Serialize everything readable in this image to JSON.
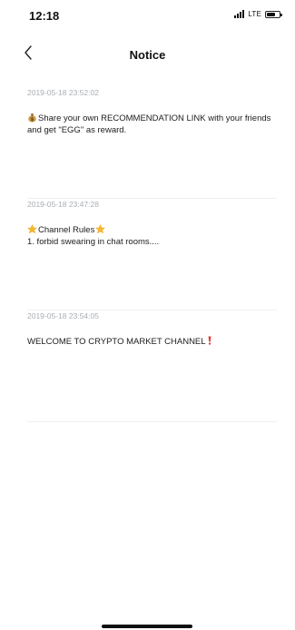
{
  "status_bar": {
    "time": "12:18",
    "network": "LTE",
    "icons": [
      "signal-icon",
      "battery-icon"
    ]
  },
  "header": {
    "title": "Notice",
    "back_icon": "chevron-left-icon"
  },
  "notices": [
    {
      "timestamp": "2019-05-18 23:52:02",
      "lead_icon": "money-bag-icon",
      "text": "Share your own RECOMMENDATION LINK with your friends and get \"EGG\" as reward."
    },
    {
      "timestamp": "2019-05-18 23:47:28",
      "title_icon": "star-icon",
      "title": "Channel Rules",
      "text": "1. forbid swearing in chat rooms...."
    },
    {
      "timestamp": "2019-05-18 23:54:05",
      "trail_icon": "exclamation-icon",
      "text": "WELCOME TO CRYPTO MARKET CHANNEL"
    }
  ],
  "colors": {
    "background": "#ffffff",
    "text": "#1c1c1c",
    "timestamp": "#a9aeb6",
    "divider": "#efefef",
    "accent_red": "#e0382f",
    "star": "#f5b82e"
  }
}
